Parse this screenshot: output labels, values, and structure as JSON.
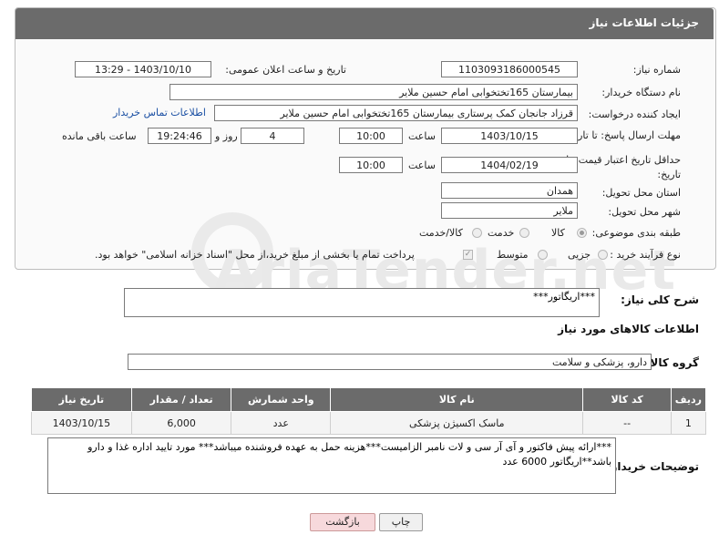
{
  "panel": {
    "title": "جزئیات اطلاعات نیاز"
  },
  "fields": {
    "need_number": {
      "label": "شماره نیاز:",
      "value": "1103093186000545"
    },
    "announce_datetime": {
      "label": "تاریخ و ساعت اعلان عمومی:",
      "value": "1403/10/10 - 13:29"
    },
    "buyer_org": {
      "label": "نام دستگاه خریدار:",
      "value": "بیمارستان 165تختخوابی امام حسین ملایر"
    },
    "requester": {
      "label": "ایجاد کننده درخواست:",
      "value": "قرزاد جانجان کمک پرستاری بیمارستان 165تختخوابی امام حسین ملایر",
      "link": "اطلاعات تماس خریدار"
    },
    "reply_deadline": {
      "label": "مهلت ارسال پاسخ: تا تاریخ:",
      "date": "1403/10/15",
      "time_label": "ساعت",
      "time": "10:00",
      "days": "4",
      "days_label": "روز و",
      "remaining": "19:24:46",
      "remaining_label": "ساعت باقی مانده"
    },
    "price_validity": {
      "label": "حداقل تاریخ اعتبار قیمت: تا تاریخ:",
      "date": "1404/02/19",
      "time_label": "ساعت",
      "time": "10:00"
    },
    "province": {
      "label": "استان محل تحویل:",
      "value": "همدان"
    },
    "city": {
      "label": "شهر محل تحویل:",
      "value": "ملایر"
    },
    "category": {
      "label": "طبقه بندی موضوعی:",
      "options": [
        "کالا",
        "خدمت",
        "کالا/خدمت"
      ],
      "selected": "کالا"
    },
    "process": {
      "label": "نوع فرآیند خرید :",
      "options": [
        "جزیی",
        "متوسط"
      ],
      "note": "پرداخت تمام یا بخشی از مبلغ خرید،از محل \"اسناد خزانه اسلامی\" خواهد بود."
    }
  },
  "description": {
    "label": "شرح کلی نیاز:",
    "value": "***اریگاتور***"
  },
  "goods_info": {
    "title": "اطلاعات کالاهای مورد نیاز"
  },
  "goods_group": {
    "label": "گروه کالا:",
    "value": "دارو، پزشکی و سلامت"
  },
  "table": {
    "headers": [
      "ردیف",
      "کد کالا",
      "نام کالا",
      "واحد شمارش",
      "تعداد / مقدار",
      "تاریخ نیاز"
    ],
    "rows": [
      [
        "1",
        "--",
        "ماسک اکسیژن پزشکی",
        "عدد",
        "6,000",
        "1403/10/15"
      ]
    ]
  },
  "buyer_notes": {
    "label": "توضیحات خریدار:",
    "value": "***ارائه پیش فاکتور و آی آر سی و لات نامبر الزامیست***هزینه حمل به عهده فروشنده میباشد*** مورد تایید اداره غذا و دارو باشد**اریگاتور 6000 عدد"
  },
  "buttons": {
    "print": "چاپ",
    "back": "بازگشت"
  },
  "watermark": "AriaTender.net"
}
